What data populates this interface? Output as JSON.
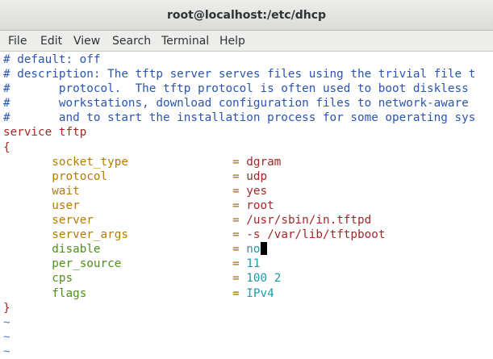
{
  "window": {
    "title": "root@localhost:/etc/dhcp"
  },
  "menu": {
    "file": "File",
    "edit": "Edit",
    "view": "View",
    "search": "Search",
    "terminal": "Terminal",
    "help": "Help"
  },
  "editor": {
    "comments": [
      "# default: off",
      "# description: The tftp server serves files using the trivial file t",
      "#       protocol.  The tftp protocol is often used to boot diskless",
      "#       workstations, download configuration files to network-aware",
      "#       and to start the installation process for some operating sys"
    ],
    "service_keyword": "service",
    "service_name": "tftp",
    "open_brace": "{",
    "close_brace": "}",
    "settings": [
      {
        "key": "socket_type",
        "value": "dgram"
      },
      {
        "key": "protocol",
        "value": "udp"
      },
      {
        "key": "wait",
        "value": "yes"
      },
      {
        "key": "user",
        "value": "root"
      },
      {
        "key": "server",
        "value": "/usr/sbin/in.tftpd"
      },
      {
        "key": "server_args",
        "value": "-s /var/lib/tftpboot"
      },
      {
        "key": "disable",
        "value": "no"
      },
      {
        "key": "per_source",
        "value": "11"
      },
      {
        "key": "cps",
        "value": "100 2"
      },
      {
        "key": "flags",
        "value": "IPv4"
      }
    ],
    "equals": "=",
    "empty_line_marker": "~",
    "empty_line_count": 3,
    "cursor_after_setting": "disable"
  }
}
